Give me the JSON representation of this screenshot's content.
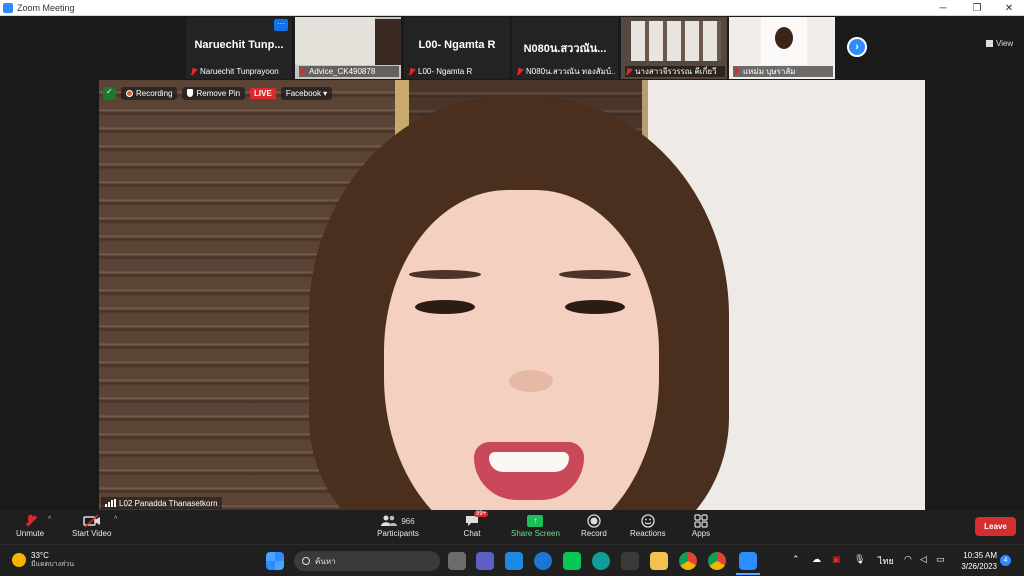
{
  "window": {
    "title": "Zoom Meeting"
  },
  "window_controls": {
    "minimize": "─",
    "maximize": "❐",
    "close": "✕"
  },
  "thumbnails": [
    {
      "display_name": "Naruechit  Tunp...",
      "label": "Naruechit Tunprayoon",
      "has_more": true
    },
    {
      "display_name": "",
      "label": "Advice_CK490878",
      "has_more": false
    },
    {
      "display_name": "L00- Ngamta R",
      "label": "L00- Ngamta R",
      "has_more": false
    },
    {
      "display_name": "N080น.สววณัน...",
      "label": "N080น.สววณัน  ทองสัมบ์...",
      "has_more": false
    },
    {
      "display_name": "",
      "label": "นางสาวจีรวรรณ คีเกี่ยวี",
      "has_more": false
    },
    {
      "display_name": "",
      "label": "แหม่ม บุษราลัม",
      "has_more": false
    }
  ],
  "strip": {
    "more_label": "···",
    "next_label": "›",
    "view_label": "View"
  },
  "overlay": {
    "recording_label": "Recording",
    "remove_pin_label": "Remove Pin",
    "live_label": "LIVE",
    "stream_label": "Facebook ▾"
  },
  "active_speaker": {
    "name": "L02 Panadda Thanasetkorn"
  },
  "toolbar": {
    "unmute_label": "Unmute",
    "start_video_label": "Start Video",
    "participants_count": "966",
    "participants_label": "Participants",
    "chat_label": "Chat",
    "chat_badge": "99+",
    "share_label": "Share Screen",
    "record_label": "Record",
    "reactions_label": "Reactions",
    "apps_label": "Apps",
    "leave_label": "Leave",
    "caret": "^"
  },
  "taskbar": {
    "temperature": "33°C",
    "weather_text": "มีแดดบางส่วน",
    "search_placeholder": "ค้นหา",
    "language": "ไทย",
    "time": "10:35 AM",
    "date": "3/26/2023",
    "notification_count": "4"
  },
  "colors": {
    "accent": "#2d8cff",
    "leave": "#d32f2f",
    "share": "#1dbf5b",
    "live": "#e02828"
  }
}
